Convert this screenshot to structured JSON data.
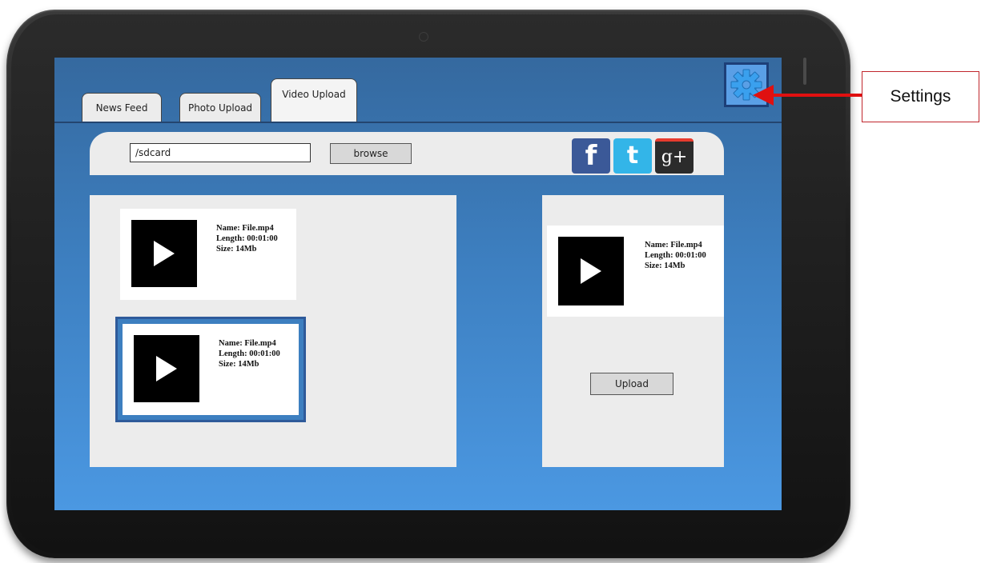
{
  "tabs": [
    {
      "label": "News Feed",
      "active": false
    },
    {
      "label": "Photo Upload",
      "active": false
    },
    {
      "label": "Video Upload",
      "active": true
    }
  ],
  "settings": {
    "icon": "gear-icon",
    "icon_color": "#3aa0ee"
  },
  "toolbar": {
    "path_value": "/sdcard",
    "browse_label": "browse",
    "social": [
      {
        "name": "facebook",
        "glyph": "f",
        "color": "#3b5998"
      },
      {
        "name": "twitter",
        "glyph": "t",
        "color": "#33b5e8"
      },
      {
        "name": "google-plus",
        "glyph": "g+",
        "color": "#2b2b2b"
      }
    ]
  },
  "file_list": [
    {
      "name": "Name: File.mp4",
      "length": "Length: 00:01:00",
      "size": "Size: 14Mb",
      "selected": false
    },
    {
      "name": "Name: File.mp4",
      "length": "Length: 00:01:00",
      "size": "Size: 14Mb",
      "selected": true
    }
  ],
  "upload_panel": {
    "name": "Name: File.mp4",
    "length": "Length: 00:01:00",
    "size": "Size: 14Mb",
    "upload_label": "Upload"
  },
  "callout": {
    "label": "Settings",
    "color": "#e01010"
  }
}
